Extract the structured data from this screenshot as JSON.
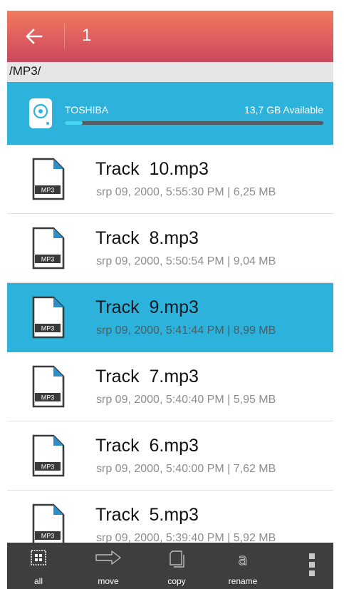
{
  "header": {
    "title": "1",
    "back_icon": "arrow-left-icon"
  },
  "path": "/MP3/",
  "storage": {
    "name": "TOSHIBA",
    "available": "13,7 GB Available",
    "used_fraction": 0.07,
    "icon": "drive-icon"
  },
  "files": [
    {
      "name": "Track  10.mp3",
      "meta": "srp 09, 2000, 5:55:30 PM | 6,25 MB",
      "type_label": "MP3",
      "selected": false
    },
    {
      "name": "Track  8.mp3",
      "meta": "srp 09, 2000, 5:50:54 PM | 9,04 MB",
      "type_label": "MP3",
      "selected": false
    },
    {
      "name": "Track  9.mp3",
      "meta": "srp 09, 2000, 5:41:44 PM | 8,99 MB",
      "type_label": "MP3",
      "selected": true
    },
    {
      "name": "Track  7.mp3",
      "meta": "srp 09, 2000, 5:40:40 PM | 5,95 MB",
      "type_label": "MP3",
      "selected": false
    },
    {
      "name": "Track  6.mp3",
      "meta": "srp 09, 2000, 5:40:00 PM | 7,62 MB",
      "type_label": "MP3",
      "selected": false
    },
    {
      "name": "Track  5.mp3",
      "meta": "srp 09, 2000, 5:39:40 PM | 5,92 MB",
      "type_label": "MP3",
      "selected": false
    }
  ],
  "toolbar": {
    "all_label": "all",
    "move_label": "move",
    "copy_label": "copy",
    "rename_label": "rename",
    "more_icon": "more-vertical-icon"
  },
  "colors": {
    "header_gradient_top": "#f07a5d",
    "header_gradient_bottom": "#c84a5e",
    "accent": "#2db2db",
    "toolbar_bg": "#3e3e3e"
  }
}
